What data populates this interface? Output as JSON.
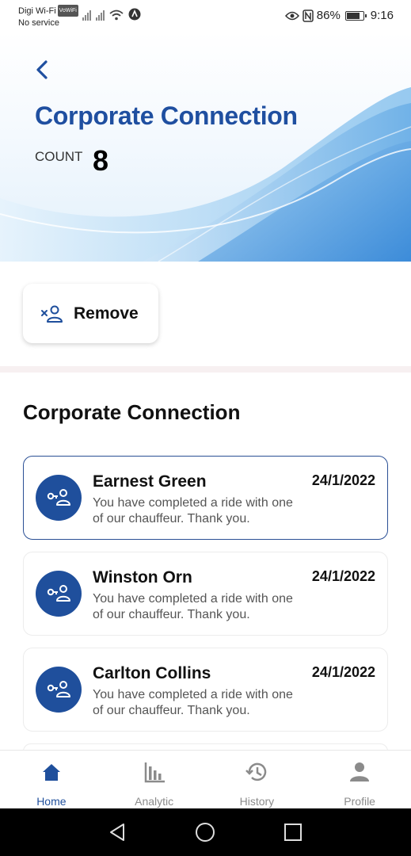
{
  "status_bar": {
    "carrier": "Digi Wi-Fi",
    "carrier_tag": "VoWiFi",
    "service": "No service",
    "battery": "86%",
    "time": "9:16"
  },
  "header": {
    "title": "Corporate Connection",
    "count_label": "COUNT",
    "count_value": "8"
  },
  "actions": {
    "remove_label": "Remove"
  },
  "list": {
    "title": "Corporate Connection",
    "items": [
      {
        "name": "Earnest Green",
        "date": "24/1/2022",
        "message": "You have completed a ride with one of our chauffeur. Thank you.",
        "selected": true
      },
      {
        "name": "Winston Orn",
        "date": "24/1/2022",
        "message": "You have completed a ride with one of our chauffeur. Thank you.",
        "selected": false
      },
      {
        "name": "Carlton Collins",
        "date": "24/1/2022",
        "message": "You have completed a ride with one of our chauffeur. Thank you.",
        "selected": false
      }
    ]
  },
  "bottom_nav": {
    "items": [
      {
        "label": "Home",
        "icon": "home-icon",
        "active": true
      },
      {
        "label": "Analytic",
        "icon": "bar-chart-icon",
        "active": false
      },
      {
        "label": "History",
        "icon": "history-icon",
        "active": false
      },
      {
        "label": "Profile",
        "icon": "person-icon",
        "active": false
      }
    ]
  },
  "colors": {
    "primary": "#1f4f9c",
    "title": "#1f4fa0",
    "inactive": "#8b8b8b"
  }
}
